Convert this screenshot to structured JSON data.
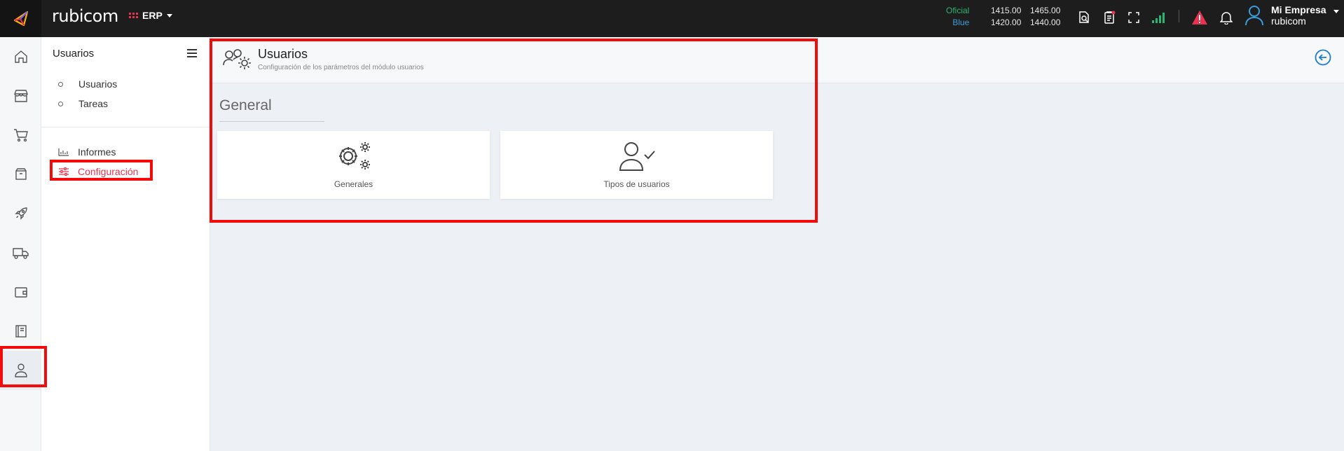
{
  "topbar": {
    "brand": "rubicom",
    "app_switch_label": "ERP",
    "rates": {
      "oficial_label": "Oficial",
      "blue_label": "Blue",
      "oficial_buy": "1415.00",
      "oficial_sell": "1465.00",
      "blue_buy": "1420.00",
      "blue_sell": "1440.00"
    },
    "user": {
      "name": "Mi Empresa",
      "company": "rubicom"
    },
    "icons": [
      "search-document-icon",
      "clipboard-icon",
      "fullscreen-icon",
      "signal-icon",
      "warning-icon",
      "bell-icon",
      "user-icon"
    ]
  },
  "rail": {
    "items": [
      "home-icon",
      "store-icon",
      "cart-icon",
      "box-icon",
      "rocket-icon",
      "truck-icon",
      "wallet-icon",
      "book-icon",
      "user-icon"
    ],
    "active": "user-icon"
  },
  "sidebar": {
    "title": "Usuarios",
    "subitems": [
      {
        "label": "Usuarios"
      },
      {
        "label": "Tareas"
      }
    ],
    "items": [
      {
        "label": "Informes",
        "icon": "chart-icon"
      },
      {
        "label": "Configuración",
        "icon": "sliders-icon",
        "active": true
      }
    ]
  },
  "page": {
    "title": "Usuarios",
    "subtitle": "Configuración de los parámetros del módulo usuarios",
    "section": "General",
    "cards": [
      {
        "label": "Generales",
        "icon": "gears-icon"
      },
      {
        "label": "Tipos de usuarios",
        "icon": "user-check-icon"
      }
    ]
  },
  "colors": {
    "accent": "#e8344e",
    "topbar": "#1d1d1d",
    "background": "#edf0f5",
    "annotation": "#f50a0a",
    "link_blue": "#1a7bd6"
  }
}
